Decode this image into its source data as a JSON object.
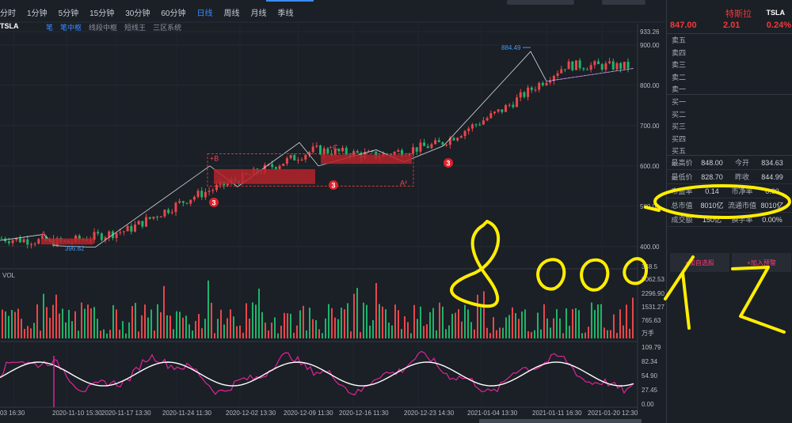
{
  "toolbar": {
    "periods": [
      "分时",
      "1分钟",
      "5分钟",
      "15分钟",
      "30分钟",
      "60分钟",
      "日线",
      "周线",
      "月线",
      "季线"
    ],
    "active_period": "日线"
  },
  "chart_header": {
    "symbol": "TSLA",
    "indicators": [
      "笔",
      "笔中枢",
      "线段中枢",
      "短线王",
      "三区系统"
    ],
    "active_indicators": [
      "笔",
      "笔中枢"
    ]
  },
  "price_axis": [
    "933.26",
    "900.00",
    "800.00",
    "700.00",
    "600.00",
    "500.00",
    "400.00"
  ],
  "vol_panel": {
    "label": "VOL",
    "axis": [
      "348.5",
      "3062.53",
      "2296.90",
      "1531.27",
      "765.63",
      "万手"
    ]
  },
  "osc_panel": {
    "axis": [
      "109.79",
      "82.34",
      "54.90",
      "27.45",
      "0.00"
    ]
  },
  "time_axis": [
    "03 16:30",
    "2020-11-10 15:30",
    "2020-11-17 13:30",
    "2020-11-24 11:30",
    "2020-12-02 13:30",
    "2020-12-09 11:30",
    "2020-12-16 11:30",
    "2020-12-23 14:30",
    "2021-01-04 13:30",
    "2021-01-11 16:30",
    "2021-01-20 12:30"
  ],
  "annotations": {
    "high": "884.49",
    "low": "396.82",
    "A": "A",
    "B": "+B",
    "C": "+C",
    "A2": "A²",
    "marker": "3"
  },
  "handwriting": "8000亿",
  "quote": {
    "name": "特斯拉",
    "code": "TSLA",
    "price": "847.00",
    "change": "2.01",
    "change_pct": "0.24%",
    "asks": [
      "卖五",
      "卖四",
      "卖三",
      "卖二",
      "卖一"
    ],
    "bids": [
      "买一",
      "买二",
      "买三",
      "买四",
      "买五"
    ],
    "stats": [
      [
        "最高价",
        "848.00",
        "今开",
        "834.63"
      ],
      [
        "最低价",
        "828.70",
        "昨收",
        "844.99"
      ],
      [
        "市盈率",
        "0.14",
        "市净率",
        "0.00"
      ],
      [
        "总市值",
        "8010亿",
        "流通市值",
        "8010亿"
      ],
      [
        "成交额",
        "150亿",
        "换手率",
        "0.00%"
      ]
    ],
    "buttons": [
      "+加自选股",
      "+加入预警"
    ]
  },
  "chart_data": {
    "type": "line",
    "title": "",
    "x_dates": [
      "2020-11-03",
      "2020-11-10",
      "2020-11-17",
      "2020-11-24",
      "2020-12-02",
      "2020-12-09",
      "2020-12-16",
      "2020-12-23",
      "2021-01-04",
      "2021-01-11",
      "2021-01-20"
    ],
    "series": [
      {
        "name": "",
        "values": [
          420,
          410,
          440,
          520,
          580,
          640,
          625,
          655,
          740,
          850,
          847
        ]
      }
    ],
    "ylim": [
      348.5,
      933.26
    ],
    "grid": true,
    "legend": "none"
  }
}
